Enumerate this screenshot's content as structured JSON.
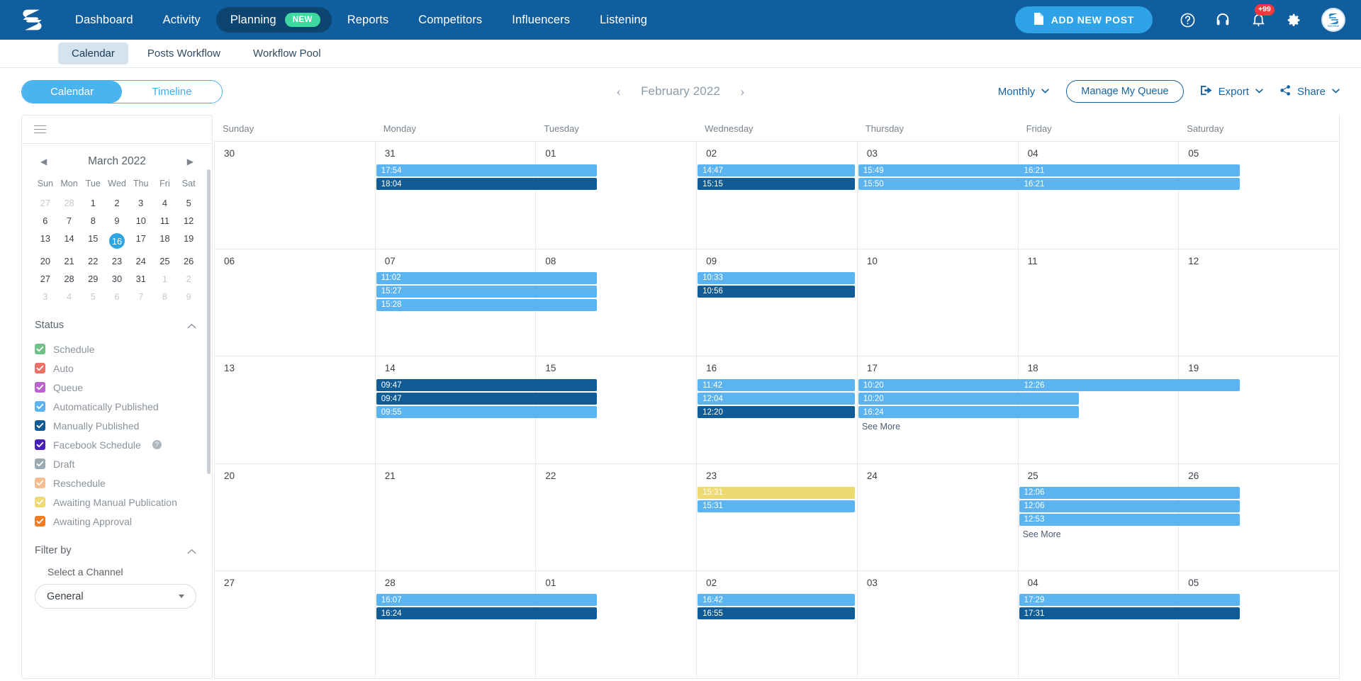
{
  "topnav": {
    "logo_name": "swonkie-logo",
    "links": [
      {
        "label": "Dashboard",
        "active": false
      },
      {
        "label": "Activity",
        "active": false
      },
      {
        "label": "Planning",
        "active": true,
        "badge": "NEW"
      },
      {
        "label": "Reports",
        "active": false
      },
      {
        "label": "Competitors",
        "active": false
      },
      {
        "label": "Influencers",
        "active": false
      },
      {
        "label": "Listening",
        "active": false
      }
    ],
    "add_post_label": "ADD NEW POST",
    "notification_count": "+99",
    "avatar_label": "swonkie"
  },
  "subnav": {
    "tabs": [
      {
        "label": "Calendar",
        "active": true
      },
      {
        "label": "Posts Workflow",
        "active": false
      },
      {
        "label": "Workflow Pool",
        "active": false
      }
    ]
  },
  "toolbar": {
    "view_toggle": [
      {
        "label": "Calendar",
        "active": true
      },
      {
        "label": "Timeline",
        "active": false
      }
    ],
    "prev_arrow": "‹",
    "current_period": "February 2022",
    "next_arrow": "›",
    "range_label": "Monthly",
    "manage_queue_label": "Manage My Queue",
    "export_label": "Export",
    "share_label": "Share"
  },
  "sidebar": {
    "minical": {
      "title": "March 2022",
      "prev": "◀",
      "next": "▶",
      "dow": [
        "Sun",
        "Mon",
        "Tue",
        "Wed",
        "Thu",
        "Fri",
        "Sat"
      ],
      "weeks": [
        [
          {
            "d": "27",
            "muted": true
          },
          {
            "d": "28",
            "muted": true
          },
          {
            "d": "1"
          },
          {
            "d": "2"
          },
          {
            "d": "3"
          },
          {
            "d": "4"
          },
          {
            "d": "5"
          }
        ],
        [
          {
            "d": "6"
          },
          {
            "d": "7"
          },
          {
            "d": "8"
          },
          {
            "d": "9"
          },
          {
            "d": "10"
          },
          {
            "d": "11"
          },
          {
            "d": "12"
          }
        ],
        [
          {
            "d": "13"
          },
          {
            "d": "14"
          },
          {
            "d": "15"
          },
          {
            "d": "16",
            "selected": true
          },
          {
            "d": "17"
          },
          {
            "d": "18"
          },
          {
            "d": "19"
          }
        ],
        [
          {
            "d": "20"
          },
          {
            "d": "21"
          },
          {
            "d": "22"
          },
          {
            "d": "23"
          },
          {
            "d": "24"
          },
          {
            "d": "25"
          },
          {
            "d": "26"
          }
        ],
        [
          {
            "d": "27"
          },
          {
            "d": "28"
          },
          {
            "d": "29"
          },
          {
            "d": "30"
          },
          {
            "d": "31"
          },
          {
            "d": "1",
            "muted": true
          },
          {
            "d": "2",
            "muted": true
          }
        ],
        [
          {
            "d": "3",
            "muted": true
          },
          {
            "d": "4",
            "muted": true
          },
          {
            "d": "5",
            "muted": true
          },
          {
            "d": "6",
            "muted": true
          },
          {
            "d": "7",
            "muted": true
          },
          {
            "d": "8",
            "muted": true
          },
          {
            "d": "9",
            "muted": true
          }
        ]
      ]
    },
    "status": {
      "title": "Status",
      "items": [
        {
          "label": "Schedule",
          "color": "#70C386",
          "checked": true
        },
        {
          "label": "Auto",
          "color": "#EC7068",
          "checked": true
        },
        {
          "label": "Queue",
          "color": "#BA62CD",
          "checked": true
        },
        {
          "label": "Automatically Published",
          "color": "#5BB4F0",
          "checked": true
        },
        {
          "label": "Manually Published",
          "color": "#0F5C96",
          "checked": true
        },
        {
          "label": "Facebook Schedule",
          "color": "#4A1FB8",
          "checked": true,
          "help": "?"
        },
        {
          "label": "Draft",
          "color": "#9BAAB4",
          "checked": true
        },
        {
          "label": "Reschedule",
          "color": "#F7BC8D",
          "checked": true
        },
        {
          "label": "Awaiting Manual Publication",
          "color": "#EFD971",
          "checked": true
        },
        {
          "label": "Awaiting Approval",
          "color": "#F47B20",
          "checked": true
        }
      ]
    },
    "filter": {
      "title": "Filter by",
      "channel_label": "Select a Channel",
      "channel_value": "General"
    }
  },
  "calendar": {
    "dow": [
      "Sunday",
      "Monday",
      "Tuesday",
      "Wednesday",
      "Thursday",
      "Friday",
      "Saturday"
    ],
    "colors": {
      "auto_published": "#5BB4F0",
      "manually_published": "#0F5C96",
      "awaiting_manual": "#EFD971"
    },
    "weeks": [
      [
        {
          "day": "30",
          "events": []
        },
        {
          "day": "31",
          "events": [
            {
              "time": "17:54",
              "color": "#5BB4F0",
              "wide": true
            },
            {
              "time": "18:04",
              "color": "#0F5C96",
              "wide": true
            }
          ]
        },
        {
          "day": "01",
          "events": []
        },
        {
          "day": "02",
          "events": [
            {
              "time": "14:47",
              "color": "#5BB4F0"
            },
            {
              "time": "15:15",
              "color": "#0F5C96"
            }
          ]
        },
        {
          "day": "03",
          "events": [
            {
              "time": "15:49",
              "color": "#5BB4F0",
              "wide": true
            },
            {
              "time": "15:50",
              "color": "#5BB4F0",
              "wide": true
            }
          ]
        },
        {
          "day": "04",
          "events": [
            {
              "time": "16:21",
              "color": "#5BB4F0",
              "wide": true
            },
            {
              "time": "16:21",
              "color": "#5BB4F0",
              "wide": true
            }
          ]
        },
        {
          "day": "05",
          "events": []
        }
      ],
      [
        {
          "day": "06",
          "events": []
        },
        {
          "day": "07",
          "events": [
            {
              "time": "11:02",
              "color": "#5BB4F0",
              "wide": true
            },
            {
              "time": "15:27",
              "color": "#5BB4F0",
              "wide": true
            },
            {
              "time": "15:28",
              "color": "#5BB4F0",
              "wide": true
            }
          ]
        },
        {
          "day": "08",
          "events": []
        },
        {
          "day": "09",
          "events": [
            {
              "time": "10:33",
              "color": "#5BB4F0"
            },
            {
              "time": "10:56",
              "color": "#0F5C96"
            }
          ]
        },
        {
          "day": "10",
          "events": []
        },
        {
          "day": "11",
          "events": []
        },
        {
          "day": "12",
          "events": []
        }
      ],
      [
        {
          "day": "13",
          "events": []
        },
        {
          "day": "14",
          "events": [
            {
              "time": "09:47",
              "color": "#0F5C96",
              "wide": true
            },
            {
              "time": "09:47",
              "color": "#0F5C96",
              "wide": true
            },
            {
              "time": "09:55",
              "color": "#5BB4F0",
              "wide": true
            }
          ]
        },
        {
          "day": "15",
          "events": []
        },
        {
          "day": "16",
          "events": [
            {
              "time": "11:42",
              "color": "#5BB4F0"
            },
            {
              "time": "12:04",
              "color": "#5BB4F0"
            },
            {
              "time": "12:20",
              "color": "#0F5C96"
            }
          ]
        },
        {
          "day": "17",
          "events": [
            {
              "time": "10:20",
              "color": "#5BB4F0",
              "wide": true
            },
            {
              "time": "10:20",
              "color": "#5BB4F0",
              "wide": true
            },
            {
              "time": "16:24",
              "color": "#5BB4F0",
              "wide": true
            }
          ],
          "see_more": "See More"
        },
        {
          "day": "18",
          "events": [
            {
              "time": "12:26",
              "color": "#5BB4F0",
              "wide": true
            }
          ]
        },
        {
          "day": "19",
          "events": []
        }
      ],
      [
        {
          "day": "20",
          "events": []
        },
        {
          "day": "21",
          "events": []
        },
        {
          "day": "22",
          "events": []
        },
        {
          "day": "23",
          "events": [
            {
              "time": "15:31",
              "color": "#EFD971"
            },
            {
              "time": "15:31",
              "color": "#5BB4F0"
            }
          ]
        },
        {
          "day": "24",
          "events": []
        },
        {
          "day": "25",
          "events": [
            {
              "time": "12:06",
              "color": "#5BB4F0",
              "wide": true
            },
            {
              "time": "12:06",
              "color": "#5BB4F0",
              "wide": true
            },
            {
              "time": "12:53",
              "color": "#5BB4F0",
              "wide": true
            }
          ],
          "see_more": "See More"
        },
        {
          "day": "26",
          "events": []
        }
      ],
      [
        {
          "day": "27",
          "events": []
        },
        {
          "day": "28",
          "events": [
            {
              "time": "16:07",
              "color": "#5BB4F0",
              "wide": true
            },
            {
              "time": "16:24",
              "color": "#0F5C96",
              "wide": true
            }
          ]
        },
        {
          "day": "01",
          "events": []
        },
        {
          "day": "02",
          "events": [
            {
              "time": "16:42",
              "color": "#5BB4F0"
            },
            {
              "time": "16:55",
              "color": "#0F5C96"
            }
          ]
        },
        {
          "day": "03",
          "events": []
        },
        {
          "day": "04",
          "events": [
            {
              "time": "17:29",
              "color": "#5BB4F0",
              "wide": true
            },
            {
              "time": "17:31",
              "color": "#0F5C96",
              "wide": true
            }
          ]
        },
        {
          "day": "05",
          "events": []
        }
      ]
    ]
  }
}
